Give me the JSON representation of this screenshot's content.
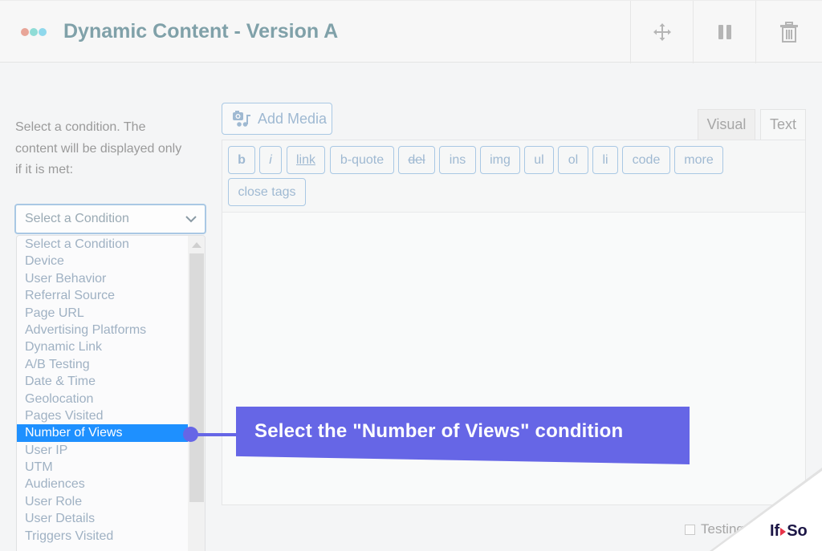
{
  "header": {
    "title": "Dynamic Content - Version A",
    "dot_colors": [
      "#e8a598",
      "#8fdcd6",
      "#8fd8ec"
    ],
    "actions": [
      {
        "name": "move",
        "icon": "move-arrows-icon"
      },
      {
        "name": "pause",
        "icon": "pause-icon"
      },
      {
        "name": "delete",
        "icon": "trash-icon"
      }
    ]
  },
  "condition_panel": {
    "hint": "Select a condition. The content will be displayed only if it is met:",
    "select_value": "Select a Condition",
    "options": [
      "Select a Condition",
      "Device",
      "User Behavior",
      "Referral Source",
      "Page URL",
      "Advertising Platforms",
      "Dynamic Link",
      "A/B Testing",
      "Date & Time",
      "Geolocation",
      "Pages Visited",
      "Number of Views",
      "User IP",
      "UTM",
      "Audiences",
      "User Role",
      "User Details",
      "Triggers Visited"
    ],
    "highlighted_option": "Number of Views"
  },
  "editor": {
    "add_media_label": "Add Media",
    "tabs": {
      "visual": "Visual",
      "text": "Text",
      "active": "Text"
    },
    "quicktags": [
      "b",
      "i",
      "link",
      "b-quote",
      "del",
      "ins",
      "img",
      "ul",
      "ol",
      "li",
      "code",
      "more",
      "close tags"
    ],
    "content": ""
  },
  "footer": {
    "testing_label": "Testing M",
    "testing_checked": false
  },
  "callout": {
    "text": "Select the \"Number of Views\" condition",
    "color": "#6666e6"
  },
  "branding": {
    "logo_left": "If",
    "logo_right": "So"
  },
  "colors": {
    "selected_option": "#1e90ff",
    "button_border": "#a9c8e4"
  }
}
